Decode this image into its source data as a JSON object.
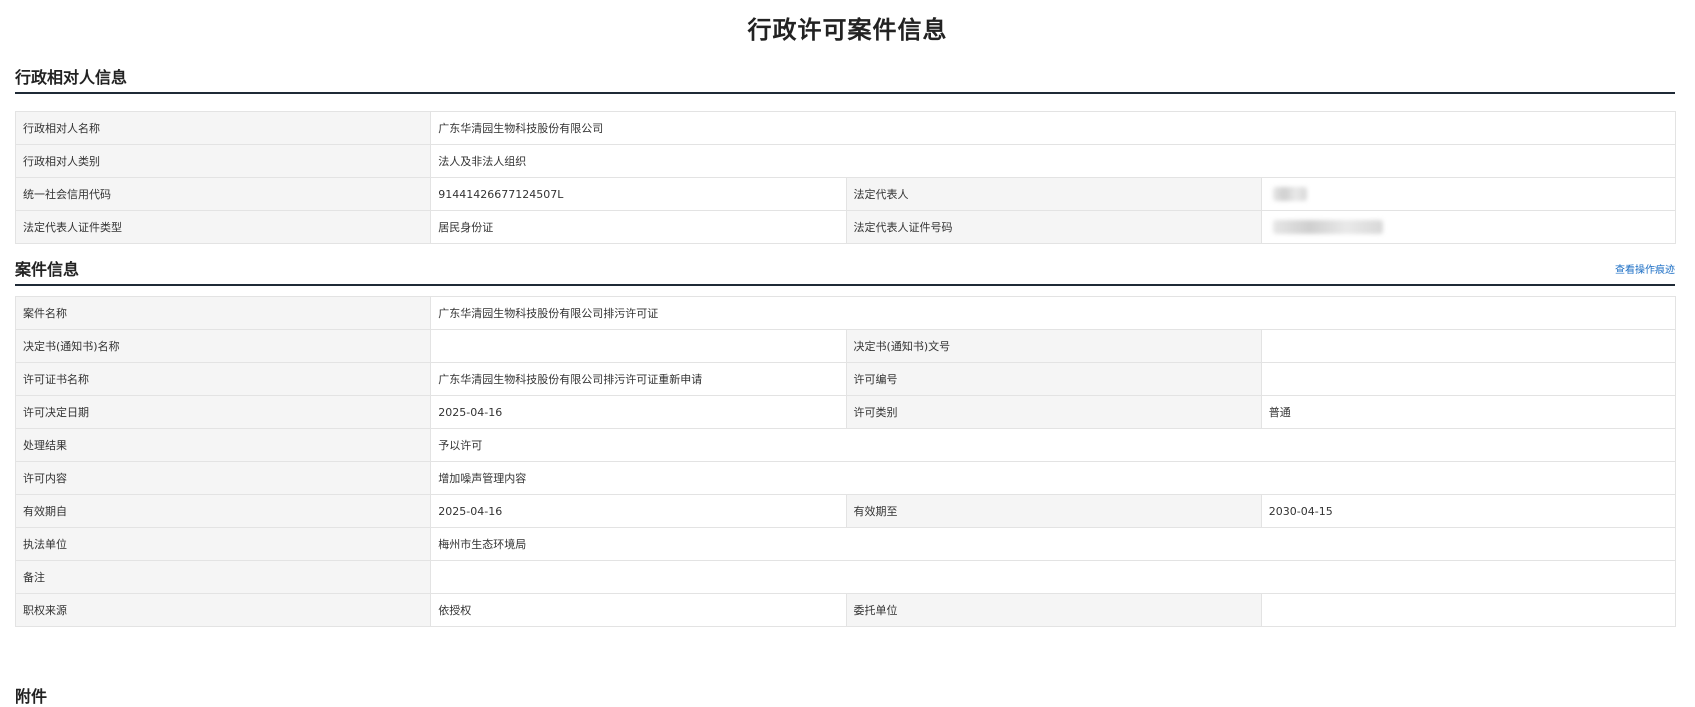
{
  "page": {
    "title": "行政许可案件信息"
  },
  "party_section": {
    "title": "行政相对人信息",
    "rows": [
      {
        "label": "行政相对人名称",
        "value": "广东华清园生物科技股份有限公司"
      },
      {
        "label": "行政相对人类别",
        "value": "法人及非法人组织"
      },
      {
        "label": "统一社会信用代码",
        "value": "91441426677124507L",
        "label2": "法定代表人",
        "value2": ""
      },
      {
        "label": "法定代表人证件类型",
        "value": "居民身份证",
        "label2": "法定代表人证件号码",
        "value2": ""
      }
    ]
  },
  "case_section": {
    "title": "案件信息",
    "link_label": "查看操作痕迹",
    "rows": [
      {
        "label": "案件名称",
        "value": "广东华清园生物科技股份有限公司排污许可证"
      },
      {
        "label": "决定书(通知书)名称",
        "value": "",
        "label2": "决定书(通知书)文号",
        "value2": ""
      },
      {
        "label": "许可证书名称",
        "value": "广东华清园生物科技股份有限公司排污许可证重新申请",
        "label2": "许可编号",
        "value2": ""
      },
      {
        "label": "许可决定日期",
        "value": "2025-04-16",
        "label2": "许可类别",
        "value2": "普通"
      },
      {
        "label": "处理结果",
        "value": "予以许可"
      },
      {
        "label": "许可内容",
        "value": "增加噪声管理内容"
      },
      {
        "label": "有效期自",
        "value": "2025-04-16",
        "label2": "有效期至",
        "value2": "2030-04-15"
      },
      {
        "label": "执法单位",
        "value": "梅州市生态环境局"
      },
      {
        "label": "备注",
        "value": ""
      },
      {
        "label": "职权来源",
        "value": "依授权",
        "label2": "委托单位",
        "value2": ""
      }
    ]
  },
  "attachment_section": {
    "title": "附件"
  },
  "colors": {
    "label_bg": "#f5f5f5",
    "border": "#e3e3e3",
    "divider": "#1f2a36",
    "link": "#1a6dc4"
  }
}
